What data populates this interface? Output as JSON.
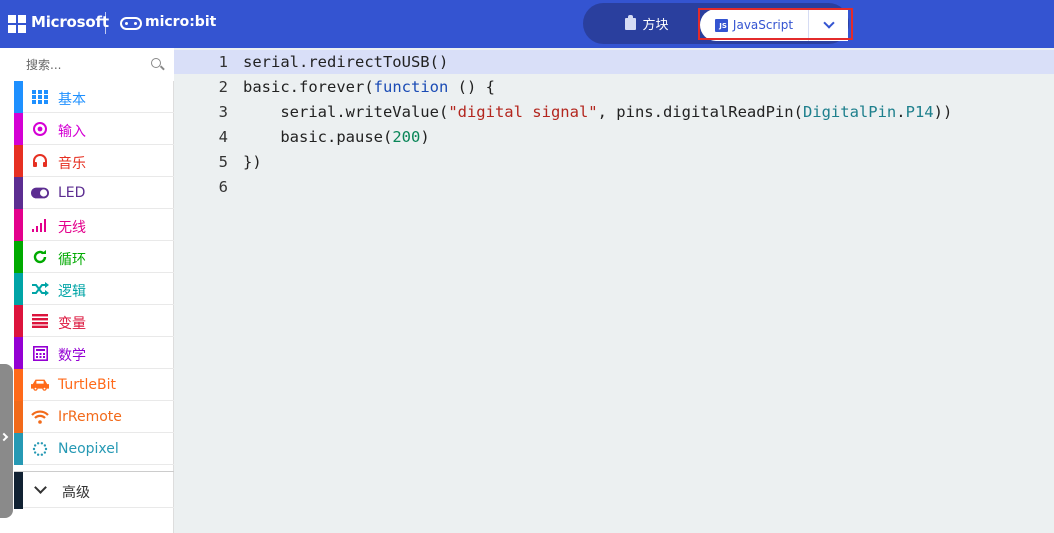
{
  "header": {
    "brand": "Microsoft",
    "product": "micro:bit",
    "blocks_label": "方块",
    "js_label": "JavaScript",
    "js_badge": "JS",
    "colors": {
      "header_bg": "#3454d1",
      "toggle_bg": "#2a3f9e",
      "highlight": "#e32b2b"
    }
  },
  "sidebar": {
    "search_placeholder": "搜索...",
    "categories": [
      {
        "label": "基本",
        "color": "#1e90ff",
        "icon": "grid-icon"
      },
      {
        "label": "输入",
        "color": "#d400d4",
        "icon": "target-icon"
      },
      {
        "label": "音乐",
        "color": "#e63022",
        "icon": "headphones-icon"
      },
      {
        "label": "LED",
        "color": "#5c2d91",
        "icon": "toggle-icon"
      },
      {
        "label": "无线",
        "color": "#e3008c",
        "icon": "signal-icon"
      },
      {
        "label": "循环",
        "color": "#00aa00",
        "icon": "refresh-icon"
      },
      {
        "label": "逻辑",
        "color": "#00a4a6",
        "icon": "shuffle-icon"
      },
      {
        "label": "变量",
        "color": "#dc143c",
        "icon": "list-icon"
      },
      {
        "label": "数学",
        "color": "#9400d3",
        "icon": "calculator-icon"
      },
      {
        "label": "TurtleBit",
        "color": "#ff6a1a",
        "icon": "car-icon"
      },
      {
        "label": "IrRemote",
        "color": "#f26a1a",
        "icon": "wifi-icon"
      },
      {
        "label": "Neopixel",
        "color": "#2699b4",
        "icon": "dots-circle-icon"
      }
    ],
    "advanced_label": "高级"
  },
  "editor": {
    "line_numbers": [
      "1",
      "2",
      "3",
      "4",
      "5",
      "6"
    ],
    "lines": [
      [
        {
          "t": "serial.redirectToUSB()",
          "c": ""
        }
      ],
      [
        {
          "t": "basic.forever(",
          "c": ""
        },
        {
          "t": "function",
          "c": "kw"
        },
        {
          "t": " () {",
          "c": ""
        }
      ],
      [
        {
          "t": "    serial.writeValue(",
          "c": ""
        },
        {
          "t": "\"digital signal\"",
          "c": "str"
        },
        {
          "t": ", pins.digitalReadPin(",
          "c": ""
        },
        {
          "t": "DigitalPin",
          "c": "teal"
        },
        {
          "t": ".",
          "c": ""
        },
        {
          "t": "P14",
          "c": "teal"
        },
        {
          "t": "))",
          "c": ""
        }
      ],
      [
        {
          "t": "    basic.pause(",
          "c": ""
        },
        {
          "t": "200",
          "c": "num"
        },
        {
          "t": ")",
          "c": ""
        }
      ],
      [
        {
          "t": "})",
          "c": ""
        }
      ],
      [
        {
          "t": "",
          "c": ""
        }
      ]
    ]
  }
}
